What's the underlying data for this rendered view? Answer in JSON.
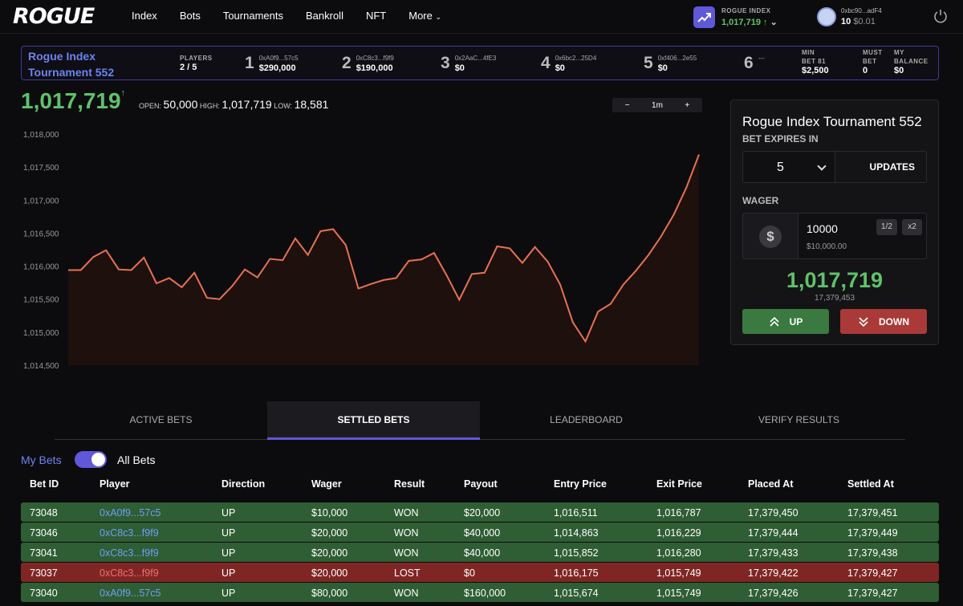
{
  "logo": "ROGUE",
  "nav": [
    "Index",
    "Bots",
    "Tournaments",
    "Bankroll",
    "NFT",
    "More"
  ],
  "rogue_index": {
    "label": "ROGUE INDEX",
    "value": "1,017,719"
  },
  "wallet": {
    "address": "0xbc90...adF4",
    "count": "10",
    "balance": "$0.01"
  },
  "tournament": {
    "title_line1": "Rogue Index",
    "title_line2": "Tournament 552",
    "players_label": "PLAYERS",
    "players_value": "2 / 5",
    "slots": [
      {
        "num": "1",
        "addr": "0xA0f9...57c5",
        "amount": "$290,000"
      },
      {
        "num": "2",
        "addr": "0xC8c3...f9f9",
        "amount": "$190,000"
      },
      {
        "num": "3",
        "addr": "0x2AaC...4fE3",
        "amount": "$0"
      },
      {
        "num": "4",
        "addr": "0x6bc2...25D4",
        "amount": "$0"
      },
      {
        "num": "5",
        "addr": "0xf406...2e55",
        "amount": "$0"
      },
      {
        "num": "6",
        "addr": "---",
        "amount": ""
      }
    ],
    "min_bet_label1": "MIN",
    "min_bet_label2": "BET 81",
    "min_bet_value": "$2,500",
    "must_bet_label1": "MUST",
    "must_bet_label2": "BET",
    "must_bet_value": "0",
    "balance_label1": "MY",
    "balance_label2": "BALANCE",
    "balance_value": "$0"
  },
  "price": {
    "current": "1,017,719",
    "open_label": "OPEN:",
    "open": "50,000",
    "high_label": "HIGH:",
    "high": "1,017,719",
    "low_label": "LOW:",
    "low": "18,581"
  },
  "zoom": {
    "minus": "−",
    "interval": "1m",
    "plus": "+"
  },
  "chart_data": {
    "type": "area",
    "ylim": [
      1014500,
      1018000
    ],
    "yticks": [
      "1,018,000",
      "1,017,500",
      "1,017,000",
      "1,016,500",
      "1,016,000",
      "1,015,500",
      "1,015,000",
      "1,014,500"
    ],
    "values": [
      1015940,
      1015940,
      1016140,
      1016240,
      1015950,
      1015940,
      1016130,
      1015740,
      1015820,
      1015680,
      1015900,
      1015520,
      1015500,
      1015700,
      1015950,
      1015830,
      1016110,
      1016090,
      1016420,
      1016170,
      1016530,
      1016560,
      1016320,
      1015660,
      1015730,
      1015790,
      1015820,
      1016080,
      1016100,
      1016200,
      1015860,
      1015490,
      1015880,
      1015900,
      1016300,
      1016270,
      1016050,
      1016290,
      1016070,
      1015720,
      1015150,
      1014860,
      1015310,
      1015430,
      1015720,
      1015930,
      1016170,
      1016450,
      1016780,
      1017190,
      1017690
    ],
    "color": "#e8714f"
  },
  "panel": {
    "title": "Rogue Index Tournament 552",
    "expires_label": "BET EXPIRES IN",
    "expires_value": "5",
    "updates_label": "UPDATES",
    "wager_label": "WAGER",
    "wager_value": "10000",
    "wager_usd": "$10,000.00",
    "half": "1/2",
    "double": "x2",
    "price": "1,017,719",
    "block": "17,379,453",
    "up": "UP",
    "down": "DOWN"
  },
  "tabs": [
    "ACTIVE BETS",
    "SETTLED BETS",
    "LEADERBOARD",
    "VERIFY RESULTS"
  ],
  "filter": {
    "my_bets": "My Bets",
    "all_bets": "All Bets"
  },
  "table": {
    "headers": [
      "Bet ID",
      "Player",
      "Direction",
      "Wager",
      "Result",
      "Payout",
      "Entry Price",
      "Exit Price",
      "Placed At",
      "Settled At"
    ],
    "rows": [
      [
        "73048",
        "0xA0f9...57c5",
        "UP",
        "$10,000",
        "WON",
        "$20,000",
        "1,016,511",
        "1,016,787",
        "17,379,450",
        "17,379,451"
      ],
      [
        "73046",
        "0xC8c3...f9f9",
        "UP",
        "$20,000",
        "WON",
        "$40,000",
        "1,014,863",
        "1,016,229",
        "17,379,444",
        "17,379,449"
      ],
      [
        "73041",
        "0xC8c3...f9f9",
        "UP",
        "$20,000",
        "WON",
        "$40,000",
        "1,015,852",
        "1,016,280",
        "17,379,433",
        "17,379,438"
      ],
      [
        "73037",
        "0xC8c3...f9f9",
        "UP",
        "$20,000",
        "LOST",
        "$0",
        "1,016,175",
        "1,015,749",
        "17,379,422",
        "17,379,427"
      ],
      [
        "73040",
        "0xA0f9...57c5",
        "UP",
        "$80,000",
        "WON",
        "$160,000",
        "1,015,674",
        "1,015,749",
        "17,379,426",
        "17,379,427"
      ]
    ]
  },
  "colors": {
    "accent": "#5f58d9",
    "green": "#60c26a",
    "won_row": "#2f5d34",
    "lost_row": "#7f2624",
    "link": "#6f83f0"
  }
}
